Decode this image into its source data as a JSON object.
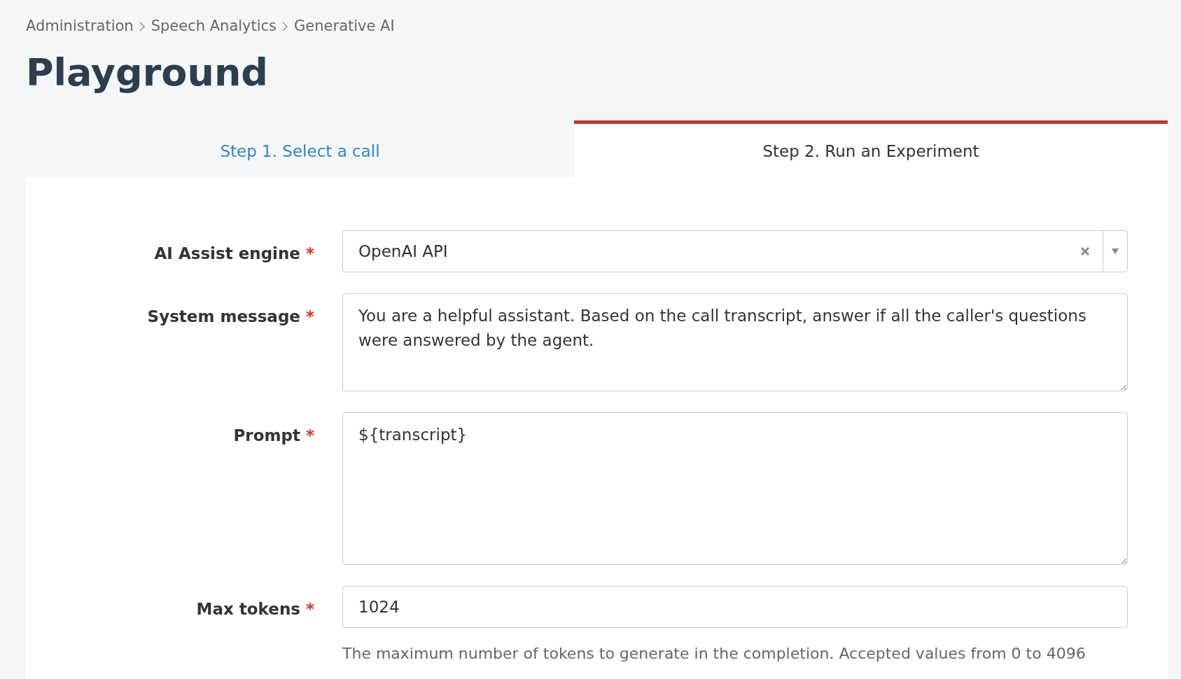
{
  "breadcrumb": [
    "Administration",
    "Speech Analytics",
    "Generative AI"
  ],
  "title": "Playground",
  "tabs": [
    {
      "label": "Step 1. Select a call",
      "selected": false
    },
    {
      "label": "Step 2. Run an Experiment",
      "selected": true
    }
  ],
  "form": [
    {
      "kind": "select",
      "label": "AI Assist engine",
      "required": "*",
      "value": "OpenAI API"
    },
    {
      "kind": "textarea",
      "label": "System message",
      "required": "*",
      "value": "You are a helpful assistant. Based on the call transcript, answer if all the caller's questions were answered by the agent."
    },
    {
      "kind": "large-textarea",
      "label": "Prompt",
      "required": "*",
      "value": "${transcript}"
    },
    {
      "kind": "input",
      "label": "Max tokens",
      "required": "*",
      "value": "1024",
      "help": "The maximum number of tokens to generate in the completion. Accepted values from 0 to 4096"
    }
  ]
}
